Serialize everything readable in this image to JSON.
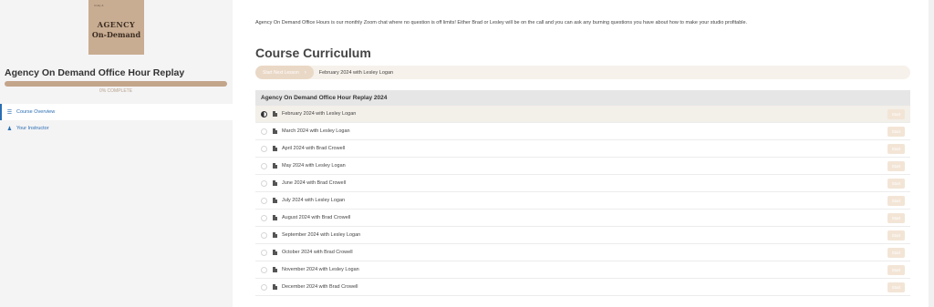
{
  "sidebar": {
    "cover": {
      "small_text": "Cindy &",
      "line1": "AGENCY",
      "line2": "On-Demand"
    },
    "course_title": "Agency On Demand Office Hour Replay",
    "progress": {
      "percent": 0,
      "label": "0% COMPLETE"
    },
    "nav": [
      {
        "label": "Course Overview",
        "icon": "list-icon",
        "active": true
      },
      {
        "label": "Your Instructor",
        "icon": "person-icon",
        "active": false
      }
    ]
  },
  "main": {
    "intro": "Agency On Demand Office Hours is our monthly Zoom chat where no question is off limits! Either Brad or Lesley will be on the call and you can ask any burning questions you have about how to make your studio profitable.",
    "curriculum_title": "Course Curriculum",
    "next_lesson": {
      "button_label": "Start Next Lesson",
      "lesson": "February 2024 with Lesley Logan"
    },
    "section": {
      "title": "Agency On Demand Office Hour Replay 2024",
      "lessons": [
        {
          "title": "February 2024 with Lesley Logan",
          "start": "Start",
          "current": true
        },
        {
          "title": "March 2024 with Lesley Logan",
          "start": "Start"
        },
        {
          "title": "April 2024 with Brad Crowell",
          "start": "Start"
        },
        {
          "title": "May 2024 with Lesley Logan",
          "start": "Start"
        },
        {
          "title": "June 2024 with Brad Crowell",
          "start": "Start"
        },
        {
          "title": "July 2024 with Lesley Logan",
          "start": "Start"
        },
        {
          "title": "August 2024 with Brad Crowell",
          "start": "Start"
        },
        {
          "title": "September 2024 with Lesley Logan",
          "start": "Start"
        },
        {
          "title": "October 2024 with Brad Crowell",
          "start": "Start"
        },
        {
          "title": "November 2024 with Lesley Logan",
          "start": "Start"
        },
        {
          "title": "December 2024 with Brad Crowell",
          "start": "Start"
        }
      ]
    }
  }
}
